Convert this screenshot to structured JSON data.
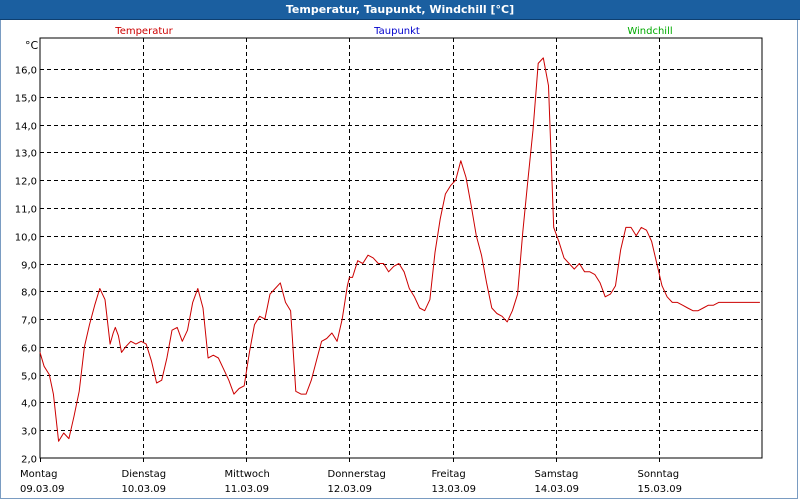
{
  "window": {
    "title": "Temperatur, Taupunkt, Windchill [°C]"
  },
  "colors": {
    "temperatur": "#cc0000",
    "taupunkt": "#0000cc",
    "windchill": "#00aa00",
    "titlebar": "#1b5fa0"
  },
  "chart_data": {
    "type": "line",
    "title": "Temperatur, Taupunkt, Windchill [°C]",
    "ylabel": "°C",
    "xlabel": "",
    "ylim": [
      2.0,
      16.8
    ],
    "yticks": [
      "2,0",
      "3,0",
      "4,0",
      "5,0",
      "6,0",
      "7,0",
      "8,0",
      "9,0",
      "10,0",
      "11,0",
      "12,0",
      "13,0",
      "14,0",
      "15,0",
      "16,0"
    ],
    "xlim": [
      0,
      7
    ],
    "xticks": [
      {
        "day": "Montag",
        "date": "09.03.09"
      },
      {
        "day": "Dienstag",
        "date": "10.03.09"
      },
      {
        "day": "Mittwoch",
        "date": "11.03.09"
      },
      {
        "day": "Donnerstag",
        "date": "12.03.09"
      },
      {
        "day": "Freitag",
        "date": "13.03.09"
      },
      {
        "day": "Samstag",
        "date": "14.03.09"
      },
      {
        "day": "Sonntag",
        "date": "15.03.09"
      }
    ],
    "grid": true,
    "legend": [
      "Temperatur",
      "Taupunkt",
      "Windchill"
    ],
    "series": [
      {
        "name": "Temperatur",
        "x": [
          0.0,
          0.04,
          0.09,
          0.13,
          0.18,
          0.23,
          0.28,
          0.33,
          0.38,
          0.43,
          0.48,
          0.53,
          0.58,
          0.63,
          0.68,
          0.71,
          0.73,
          0.76,
          0.79,
          0.83,
          0.88,
          0.93,
          0.98,
          1.03,
          1.08,
          1.13,
          1.18,
          1.23,
          1.28,
          1.33,
          1.38,
          1.43,
          1.48,
          1.53,
          1.58,
          1.63,
          1.68,
          1.73,
          1.78,
          1.83,
          1.88,
          1.93,
          1.98,
          2.03,
          2.08,
          2.13,
          2.18,
          2.23,
          2.28,
          2.33,
          2.38,
          2.43,
          2.48,
          2.53,
          2.58,
          2.63,
          2.68,
          2.73,
          2.78,
          2.83,
          2.88,
          2.93,
          2.98,
          3.0,
          3.03,
          3.08,
          3.13,
          3.18,
          3.23,
          3.28,
          3.33,
          3.38,
          3.43,
          3.48,
          3.53,
          3.58,
          3.63,
          3.68,
          3.73,
          3.78,
          3.83,
          3.88,
          3.93,
          3.98,
          4.03,
          4.08,
          4.13,
          4.18,
          4.23,
          4.28,
          4.33,
          4.38,
          4.43,
          4.48,
          4.53,
          4.58,
          4.63,
          4.68,
          4.73,
          4.78,
          4.83,
          4.88,
          4.93,
          4.98,
          5.03,
          5.08,
          5.13,
          5.18,
          5.23,
          5.28,
          5.33,
          5.38,
          5.43,
          5.48,
          5.53,
          5.58,
          5.63,
          5.68,
          5.73,
          5.78,
          5.83,
          5.88,
          5.93,
          5.98,
          6.03,
          6.08,
          6.13,
          6.18,
          6.23,
          6.28,
          6.33,
          6.38,
          6.43,
          6.48,
          6.53,
          6.58,
          6.63,
          6.68,
          6.73,
          6.78,
          6.83,
          6.88,
          6.93,
          6.98
        ],
        "values": [
          5.8,
          5.3,
          5.0,
          4.3,
          2.6,
          2.9,
          2.7,
          3.5,
          4.4,
          6.0,
          6.8,
          7.5,
          8.1,
          7.7,
          6.1,
          6.5,
          6.7,
          6.4,
          5.8,
          6.0,
          6.2,
          6.1,
          6.2,
          6.1,
          5.5,
          4.7,
          4.8,
          5.6,
          6.6,
          6.7,
          6.2,
          6.6,
          7.6,
          8.1,
          7.4,
          5.6,
          5.7,
          5.6,
          5.2,
          4.8,
          4.3,
          4.5,
          4.6,
          5.8,
          6.8,
          7.1,
          7.0,
          7.9,
          8.1,
          8.3,
          7.6,
          7.3,
          4.4,
          4.3,
          4.3,
          4.8,
          5.5,
          6.2,
          6.3,
          6.5,
          6.2,
          7.0,
          8.2,
          8.5,
          8.5,
          9.1,
          9.0,
          9.3,
          9.2,
          9.0,
          9.0,
          8.7,
          8.9,
          9.0,
          8.7,
          8.1,
          7.8,
          7.4,
          7.3,
          7.7,
          9.4,
          10.6,
          11.5,
          11.8,
          12.0,
          12.7,
          12.1,
          11.1,
          10.0,
          9.3,
          8.3,
          7.4,
          7.2,
          7.1,
          6.9,
          7.3,
          7.9,
          10.1,
          12.0,
          13.8,
          16.2,
          16.4,
          15.4,
          10.3,
          9.8,
          9.2,
          9.0,
          8.8,
          9.0,
          8.7,
          8.7,
          8.6,
          8.3,
          7.8,
          7.9,
          8.2,
          9.5,
          10.3,
          10.3,
          10.0,
          10.3,
          10.2,
          9.8,
          9.0,
          8.2,
          7.8,
          7.6,
          7.6,
          7.5,
          7.4,
          7.3,
          7.3,
          7.4,
          7.5,
          7.5,
          7.6,
          7.6,
          7.6,
          7.6,
          7.6,
          7.6,
          7.6,
          7.6,
          7.6
        ]
      }
    ]
  }
}
